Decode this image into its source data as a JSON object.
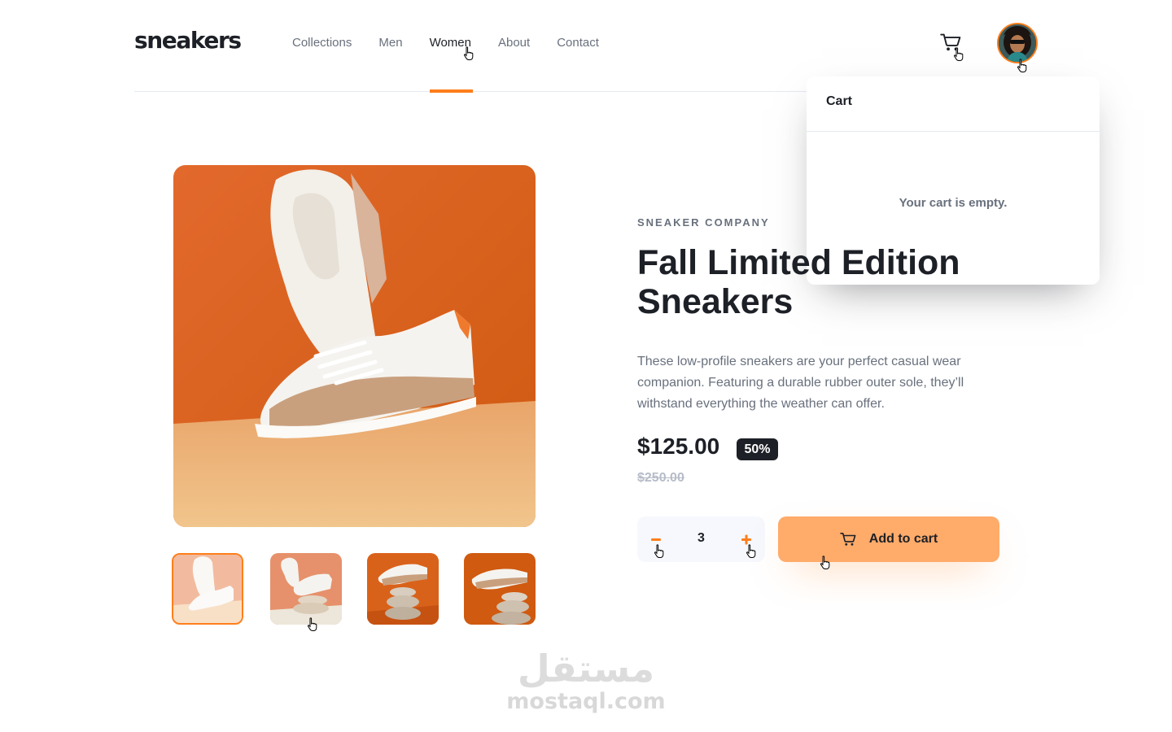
{
  "header": {
    "logo": "sneakers",
    "nav": [
      "Collections",
      "Men",
      "Women",
      "About",
      "Contact"
    ],
    "active_nav": "Women"
  },
  "cart": {
    "title": "Cart",
    "empty_message": "Your cart is empty."
  },
  "gallery": {
    "main_alt": "Fall Limited Edition Sneakers",
    "thumbnail_count": 4,
    "active_thumbnail": 1
  },
  "product": {
    "company": "SNEAKER COMPANY",
    "title": "Fall Limited Edition Sneakers",
    "description": "These low-profile sneakers are your perfect casual wear companion. Featuring a durable rubber outer sole, they’ll withstand everything the weather can offer.",
    "price": "$125.00",
    "discount": "50%",
    "original_price": "$250.00",
    "quantity": "3",
    "add_to_cart_label": "Add to cart"
  },
  "watermark": {
    "arabic": "مستقل",
    "latin": "mostaql.com"
  },
  "colors": {
    "accent": "#ff7e1b",
    "accent_pale": "#ffab6a",
    "dark": "#1d2026",
    "muted": "#69707d",
    "pale_bg": "#f6f8fd"
  },
  "icons": [
    "cart-icon",
    "avatar-icon",
    "minus-icon",
    "plus-icon",
    "pointer-cursor-icon"
  ]
}
